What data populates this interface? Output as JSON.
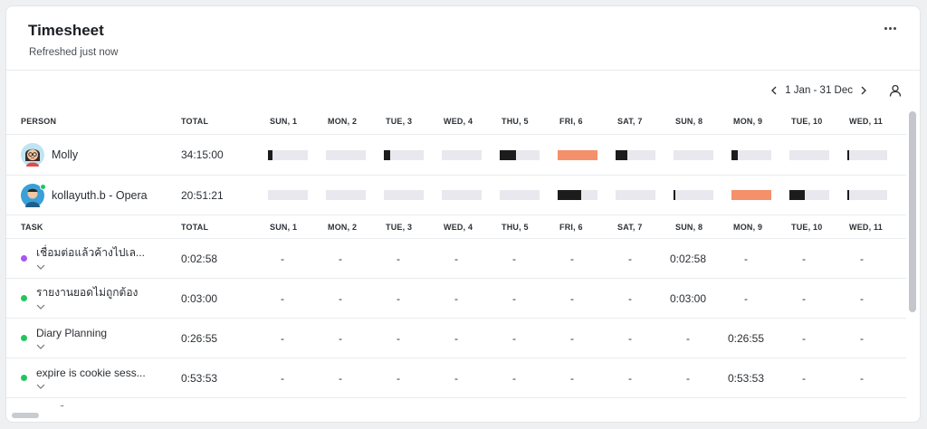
{
  "header": {
    "title": "Timesheet",
    "subtitle": "Refreshed just now",
    "more_icon": "more-horizontal-icon"
  },
  "date_nav": {
    "range": "1 Jan - 31 Dec",
    "prev_icon": "chevron-left-icon",
    "next_icon": "chevron-right-icon",
    "user_icon": "user-icon"
  },
  "colors": {
    "bar_track": "#e8e8ee",
    "bar_fill": "#1c1c1c",
    "bar_over": "#f4906a",
    "online": "#22c55e"
  },
  "days": [
    "SUN, 1",
    "MON, 2",
    "TUE, 3",
    "WED, 4",
    "THU, 5",
    "FRI, 6",
    "SAT, 7",
    "SUN, 8",
    "MON, 9",
    "TUE, 10",
    "WED, 11"
  ],
  "people_header": {
    "person": "PERSON",
    "total": "TOTAL"
  },
  "people": [
    {
      "name": "Molly",
      "total": "34:15:00",
      "online": false,
      "bars": [
        0.12,
        0,
        0.15,
        0,
        0.4,
        1.0,
        0.3,
        0,
        0.15,
        0,
        0.04
      ],
      "over": [
        false,
        false,
        false,
        false,
        false,
        true,
        false,
        false,
        false,
        false,
        false
      ]
    },
    {
      "name": "kollayuth.b - Opera",
      "total": "20:51:21",
      "online": true,
      "bars": [
        0,
        0,
        0,
        0,
        0,
        0.6,
        0,
        0.03,
        1.0,
        0.38,
        0.03
      ],
      "over": [
        false,
        false,
        false,
        false,
        false,
        false,
        false,
        false,
        true,
        false,
        false
      ]
    }
  ],
  "tasks_header": {
    "task": "TASK",
    "total": "TOTAL"
  },
  "tasks": [
    {
      "name": "เชื่อมต่อแล้วค้างไปเล...",
      "color": "#a855f7",
      "total": "0:02:58",
      "values": [
        "-",
        "-",
        "-",
        "-",
        "-",
        "-",
        "-",
        "0:02:58",
        "-",
        "-",
        "-"
      ]
    },
    {
      "name": "รายงานยอดไม่ถูกต้อง",
      "color": "#22c55e",
      "total": "0:03:00",
      "values": [
        "-",
        "-",
        "-",
        "-",
        "-",
        "-",
        "-",
        "0:03:00",
        "-",
        "-",
        "-"
      ]
    },
    {
      "name": "Diary Planning",
      "color": "#22c55e",
      "total": "0:26:55",
      "values": [
        "-",
        "-",
        "-",
        "-",
        "-",
        "-",
        "-",
        "-",
        "0:26:55",
        "-",
        "-"
      ]
    },
    {
      "name": "expire is cookie sess...",
      "color": "#22c55e",
      "total": "0:53:53",
      "values": [
        "-",
        "-",
        "-",
        "-",
        "-",
        "-",
        "-",
        "-",
        "0:53:53",
        "-",
        "-"
      ]
    },
    {
      "name": "ย้ายเว็บจาก Digital o...",
      "color": "#22c55e",
      "total": "",
      "values": [
        "",
        "",
        "",
        "",
        "",
        "",
        "",
        "",
        "",
        "",
        ""
      ]
    }
  ]
}
